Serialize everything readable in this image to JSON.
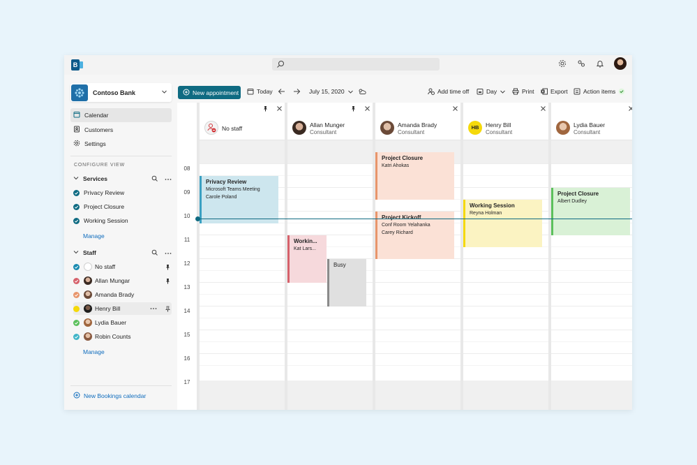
{
  "topbar": {
    "brand_letter": "B",
    "search_placeholder": ""
  },
  "sidebar": {
    "org_name": "Contoso Bank",
    "nav": [
      {
        "label": "Calendar",
        "icon": "calendar-icon",
        "active": true
      },
      {
        "label": "Customers",
        "icon": "customers-icon"
      },
      {
        "label": "Settings",
        "icon": "gear-icon"
      }
    ],
    "configure_label": "CONFIGURE VIEW",
    "services": {
      "heading": "Services",
      "items": [
        {
          "label": "Privacy Review",
          "color": "#0f6b82"
        },
        {
          "label": "Project Closure",
          "color": "#0f6b82"
        },
        {
          "label": "Working Session",
          "color": "#0f6b82"
        }
      ],
      "manage": "Manage"
    },
    "staff": {
      "heading": "Staff",
      "items": [
        {
          "label": "No staff",
          "color": "#1a8bb0"
        },
        {
          "label": "Allan Mungar",
          "color": "#d6616b"
        },
        {
          "label": "Amanda Brady",
          "color": "#e8956b"
        },
        {
          "label": "Henry Bill",
          "color": "#f5d90a"
        },
        {
          "label": "Lydia Bauer",
          "color": "#5cc05c"
        },
        {
          "label": "Robin Counts",
          "color": "#40b5c8"
        }
      ],
      "manage": "Manage"
    },
    "new_calendar": "New Bookings calendar"
  },
  "toolbar": {
    "new_appointment": "New appointment",
    "today": "Today",
    "date": "July 15, 2020",
    "add_time_off": "Add time off",
    "view": "Day",
    "print": "Print",
    "export": "Export",
    "action_items": "Action items"
  },
  "calendar": {
    "hours": [
      "08",
      "09",
      "10",
      "11",
      "12",
      "13",
      "14",
      "15",
      "16",
      "17"
    ],
    "columns": [
      {
        "name": "No staff",
        "role": ""
      },
      {
        "name": "Allan Munger",
        "role": "Consultant"
      },
      {
        "name": "Amanda Brady",
        "role": "Consultant"
      },
      {
        "name": "Henry Bill",
        "role": "Consultant",
        "initials": "HB"
      },
      {
        "name": "Lydia Bauer",
        "role": "Consultant"
      }
    ],
    "appointments": {
      "privacy": {
        "title": "Privacy Review",
        "line1": "Microsoft Teams Meeting",
        "line2": "Carole Poland"
      },
      "working_allan": {
        "title": "Workin...",
        "line1": "Kat Lars..."
      },
      "busy": {
        "title": "Busy"
      },
      "closure_amanda": {
        "title": "Project Closure",
        "line1": "Katri Ahokas"
      },
      "kickoff": {
        "title": "Project Kickoff",
        "line1": "Conf Room Yelahanka",
        "line2": "Carey Richard"
      },
      "working_henry": {
        "title": "Working Session",
        "line1": "Reyna Holman"
      },
      "closure_lydia": {
        "title": "Project Closure",
        "line1": "Albert Dudley"
      }
    }
  }
}
